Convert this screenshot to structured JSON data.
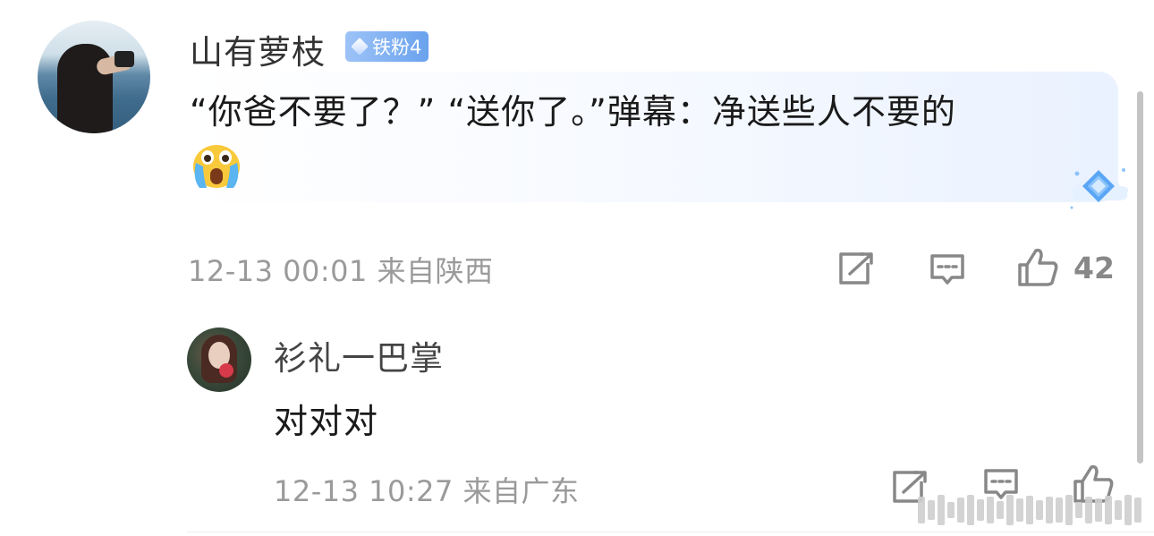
{
  "main_comment": {
    "username": "山有萝枝",
    "fan_badge": {
      "icon": "diamond-icon",
      "label": "铁粉4",
      "color": "#6aa2ee"
    },
    "text": "“你爸不要了？” “送你了。”弹幕：净送些人不要的",
    "emoji": "crying-face-emoji",
    "timestamp": "12-13 00:01",
    "location": "来自陕西",
    "actions": {
      "share_icon": "share-icon",
      "reply_icon": "comment-icon",
      "like_icon": "thumbs-up-icon",
      "like_count": "42"
    }
  },
  "reply": {
    "username": "衫礼一巴掌",
    "text": "对对对",
    "timestamp": "12-13 10:27",
    "location": "来自广东",
    "actions": {
      "share_icon": "share-icon",
      "reply_icon": "comment-icon",
      "like_icon": "thumbs-up-icon"
    }
  }
}
